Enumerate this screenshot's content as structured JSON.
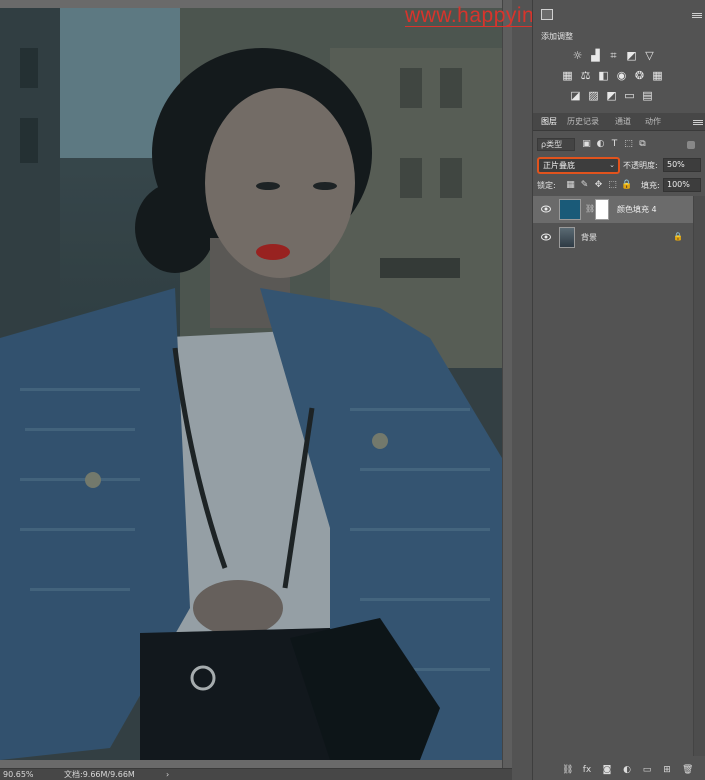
{
  "watermark": "www.happyindianshaji.com",
  "status_bar": {
    "zoom": "90.65%",
    "doc_info": "文档:9.66M/9.66M",
    "arrow": "›"
  },
  "adjustments": {
    "title": "添加调整",
    "row1_icons": [
      "brightness-icon",
      "levels-icon",
      "curves-icon",
      "exposure-icon",
      "vibrance-icon"
    ],
    "row2_icons": [
      "hue-saturation-icon",
      "color-balance-icon",
      "black-white-icon",
      "photo-filter-icon",
      "channel-mixer-icon",
      "color-lookup-icon"
    ],
    "row3_icons": [
      "invert-icon",
      "posterize-icon",
      "threshold-icon",
      "selective-color-icon",
      "gradient-map-icon"
    ]
  },
  "layers_panel": {
    "tabs": [
      "图层",
      "历史记录",
      "通道",
      "动作"
    ],
    "active_tab": "图层",
    "filter_label": "ρ类型",
    "blend_mode": "正片叠底",
    "opacity_label": "不透明度:",
    "opacity_value": "50%",
    "lock_label": "锁定:",
    "fill_label": "填充:",
    "fill_value": "100%",
    "layers": [
      {
        "name": "颜色填充 4",
        "selected": true,
        "thumb_color": "#1a5a78"
      },
      {
        "name": "背景",
        "selected": false,
        "locked": true
      }
    ]
  },
  "colors": {
    "blend_highlight": "#e1531d",
    "watermark": "#d8342c",
    "panel_bg": "#535353"
  }
}
